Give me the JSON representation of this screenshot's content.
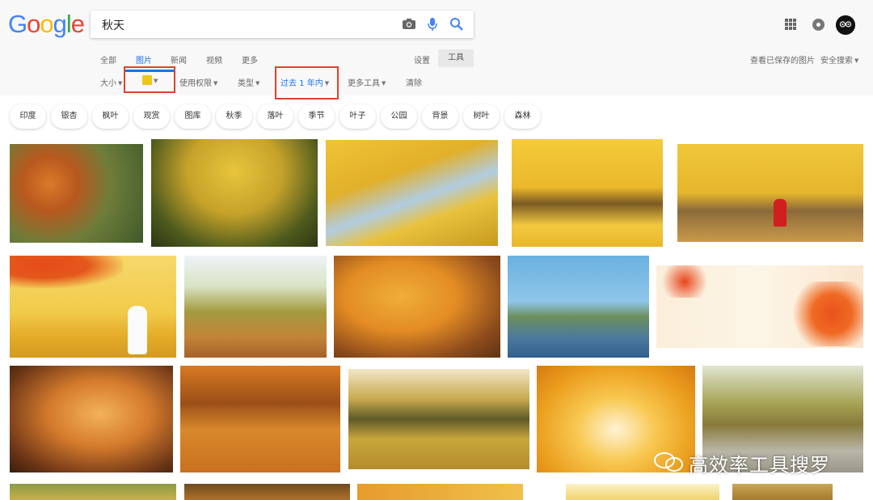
{
  "logo": {
    "letters": [
      "G",
      "o",
      "o",
      "g",
      "l",
      "e"
    ],
    "colors": [
      "#4285F4",
      "#EA4335",
      "#FBBC05",
      "#4285F4",
      "#34A853",
      "#EA4335"
    ]
  },
  "search": {
    "query": "秋天"
  },
  "tabs": [
    {
      "label": "全部",
      "active": false
    },
    {
      "label": "图片",
      "active": true
    },
    {
      "label": "新闻",
      "active": false
    },
    {
      "label": "视频",
      "active": false
    },
    {
      "label": "更多",
      "active": false
    }
  ],
  "settings_label": "设置",
  "tools_label": "工具",
  "saved_images_label": "查看已保存的图片",
  "safesearch_label": "安全搜索",
  "filters": {
    "size": "大小",
    "color_swatch": "#f0c419",
    "usage_rights": "使用权限",
    "type": "类型",
    "time": "过去 1 年内",
    "more_tools": "更多工具",
    "clear": "清除"
  },
  "chips": [
    "印度",
    "银杏",
    "枫叶",
    "观赏",
    "图库",
    "秋季",
    "落叶",
    "季节",
    "叶子",
    "公园",
    "背景",
    "树叶",
    "森林"
  ],
  "images": [
    {
      "name": "autumn-forest-orange"
    },
    {
      "name": "yellow-tree-canopy"
    },
    {
      "name": "ginkgo-branches"
    },
    {
      "name": "ginkgo-avenue"
    },
    {
      "name": "ginkgo-avenue-red-coat"
    },
    {
      "name": "maple-girl-field-illustration"
    },
    {
      "name": "tree-over-pond"
    },
    {
      "name": "orange-tree-park"
    },
    {
      "name": "lake-trees-reflection"
    },
    {
      "name": "maple-leaves-banner"
    },
    {
      "name": "deer-in-autumn-forest"
    },
    {
      "name": "leaf-covered-forest-floor"
    },
    {
      "name": "park-lawn-yellow-leaves"
    },
    {
      "name": "golden-trees-bright-sky"
    },
    {
      "name": "tree-lined-walkway"
    }
  ],
  "watermark": "高效率工具搜罗"
}
